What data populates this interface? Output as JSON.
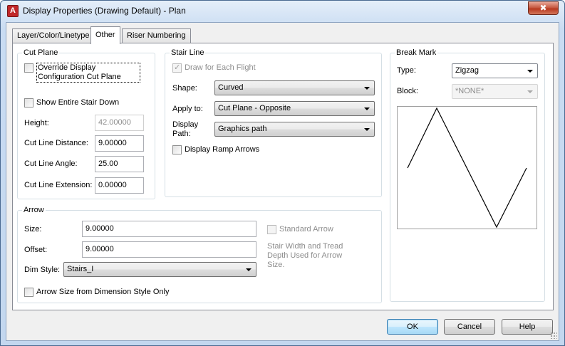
{
  "window": {
    "title": "Display Properties (Drawing Default) - Plan",
    "app_icon": "A",
    "close_glyph": "✖"
  },
  "tabs": [
    {
      "label": "Layer/Color/Linetype",
      "active": false
    },
    {
      "label": "Other",
      "active": true
    },
    {
      "label": "Riser Numbering",
      "active": false
    }
  ],
  "cut_plane": {
    "title": "Cut Plane",
    "override_label": "Override Display Configuration Cut Plane",
    "override_checked": false,
    "show_entire_label": "Show Entire Stair Down",
    "show_entire_checked": false,
    "height_label": "Height:",
    "height_value": "42.00000",
    "cut_line_distance_label": "Cut Line Distance:",
    "cut_line_distance_value": "9.00000",
    "cut_line_angle_label": "Cut Line Angle:",
    "cut_line_angle_value": "25.00",
    "cut_line_extension_label": "Cut Line Extension:",
    "cut_line_extension_value": "0.00000"
  },
  "stair_line": {
    "title": "Stair Line",
    "draw_each_flight_label": "Draw for Each Flight",
    "draw_each_flight_checked": true,
    "shape_label": "Shape:",
    "shape_value": "Curved",
    "apply_to_label": "Apply to:",
    "apply_to_value": "Cut Plane - Opposite",
    "display_path_label": "Display Path:",
    "display_path_value": "Graphics path",
    "display_ramp_arrows_label": "Display Ramp Arrows",
    "display_ramp_arrows_checked": false
  },
  "break_mark": {
    "title": "Break Mark",
    "type_label": "Type:",
    "type_value": "Zigzag",
    "block_label": "Block:",
    "block_value": "*NONE*"
  },
  "arrow": {
    "title": "Arrow",
    "size_label": "Size:",
    "size_value": "9.00000",
    "offset_label": "Offset:",
    "offset_value": "9.00000",
    "dim_style_label": "Dim Style:",
    "dim_style_value": "Stairs_I",
    "arrow_size_from_dim_label": "Arrow Size from Dimension Style Only",
    "arrow_size_from_dim_checked": false,
    "standard_arrow_label": "Standard Arrow",
    "standard_arrow_checked": false,
    "standard_arrow_note": "Stair Width and Tread Depth Used for Arrow Size."
  },
  "buttons": {
    "ok": "OK",
    "cancel": "Cancel",
    "help": "Help"
  }
}
